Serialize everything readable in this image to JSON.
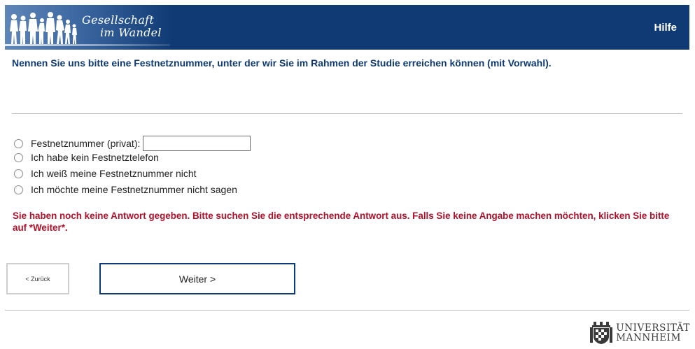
{
  "header": {
    "logo_line1": "Gesellschaft",
    "logo_line2": "im Wandel",
    "help_label": "Hilfe"
  },
  "question": "Nennen Sie uns bitte eine Festnetznummer, unter der wir Sie im Rahmen der Studie erreichen können (mit Vorwahl).",
  "options": [
    {
      "label": "Festnetznummer (privat):"
    },
    {
      "label": "Ich habe kein Festnetztelefon"
    },
    {
      "label": "Ich weiß meine Festnetznummer nicht"
    },
    {
      "label": "Ich möchte meine Festnetznummer nicht sagen"
    }
  ],
  "phone_input": {
    "value": ""
  },
  "error_message": "Sie haben noch keine Antwort gegeben. Bitte suchen Sie die entsprechende Antwort aus. Falls Sie keine Angabe machen möchten, klicken Sie bitte auf *Weiter*.",
  "buttons": {
    "back_label": "< Zurück",
    "next_label": "Weiter >"
  },
  "university": {
    "line1": "UNIVERSITÄT",
    "line2": "MANNHEIM"
  },
  "colors": {
    "header_bg": "#0f3a73",
    "question_text": "#0f3a73",
    "error_text": "#b0102a"
  }
}
